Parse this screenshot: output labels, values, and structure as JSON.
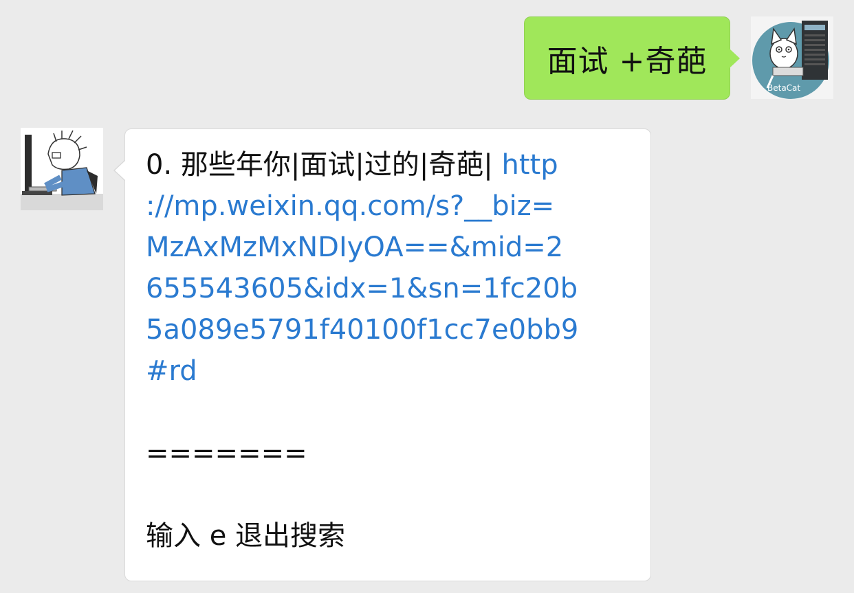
{
  "conversation": {
    "sent_message": {
      "text": "面试 +奇葩",
      "avatar_label": "BetaCat"
    },
    "received_message": {
      "line_1_prefix": "0. 那些年你|面试|过的|奇葩| ",
      "link_lines": [
        "http",
        "://mp.weixin.qq.com/s?__biz=",
        "MzAxMzMxNDIyOA==&mid=2",
        "655543605&idx=1&sn=1fc20b",
        "5a089e5791f40100f1cc7e0bb9",
        "#rd"
      ],
      "separator": "=======",
      "footer": "输入 e 退出搜索"
    }
  },
  "colors": {
    "background": "#ebebeb",
    "sent_bubble": "#a0e75a",
    "received_bubble": "#ffffff",
    "link": "#2a7ad0"
  },
  "icons": {
    "sent_avatar": "cat-with-server-avatar-icon",
    "received_avatar": "person-at-computer-avatar-icon"
  }
}
